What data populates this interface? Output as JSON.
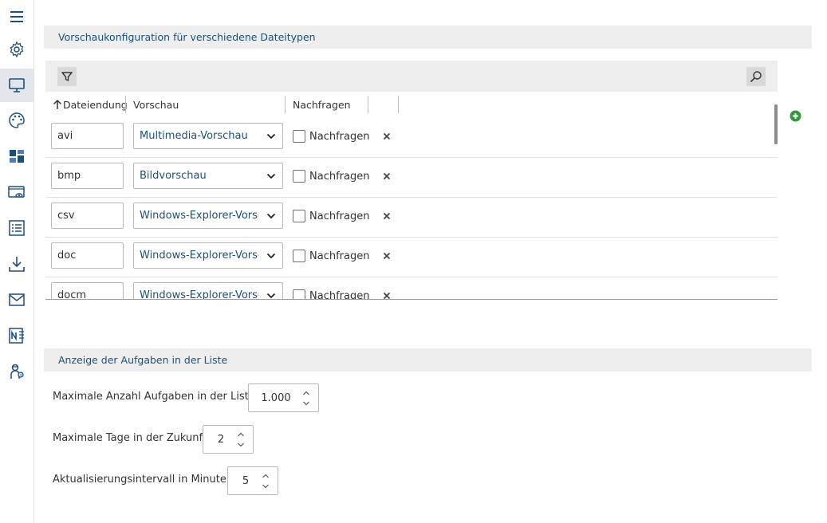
{
  "sidebar": {
    "items": [
      {
        "name": "menu-icon"
      },
      {
        "name": "gear-icon"
      },
      {
        "name": "monitor-icon"
      },
      {
        "name": "palette-icon"
      },
      {
        "name": "dashboard-icon"
      },
      {
        "name": "preview-eye-icon"
      },
      {
        "name": "list-icon"
      },
      {
        "name": "download-icon"
      },
      {
        "name": "mail-icon"
      },
      {
        "name": "onenote-icon"
      },
      {
        "name": "agent-icon"
      }
    ],
    "active_index": 2
  },
  "preview_section": {
    "title": "Vorschaukonfiguration für verschiedene Dateitypen"
  },
  "grid": {
    "columns": {
      "extension": "Dateiendung",
      "preview": "Vorschau",
      "ask": "Nachfragen"
    },
    "rows": [
      {
        "extension": "avi",
        "preview": "Multimedia-Vorschau",
        "ask_label": "Nachfragen"
      },
      {
        "extension": "bmp",
        "preview": "Bildvorschau",
        "ask_label": "Nachfragen"
      },
      {
        "extension": "csv",
        "preview": "Windows-Explorer-Vorschau",
        "ask_label": "Nachfragen"
      },
      {
        "extension": "doc",
        "preview": "Windows-Explorer-Vorschau",
        "ask_label": "Nachfragen"
      },
      {
        "extension": "docm",
        "preview": "Windows-Explorer-Vorschau",
        "ask_label": "Nachfragen"
      }
    ]
  },
  "tasks_section": {
    "title": "Anzeige der Aufgaben in der Liste",
    "max_tasks_label": "Maximale Anzahl Aufgaben in der Liste",
    "max_tasks_value": "1.000",
    "max_days_label": "Maximale Tage in der Zukunft",
    "max_days_value": "2",
    "refresh_label": "Aktualisierungsintervall in Minuten",
    "refresh_value": "5"
  },
  "colors": {
    "accent": "#1c4f7e",
    "add_green": "#2e9a3a"
  }
}
